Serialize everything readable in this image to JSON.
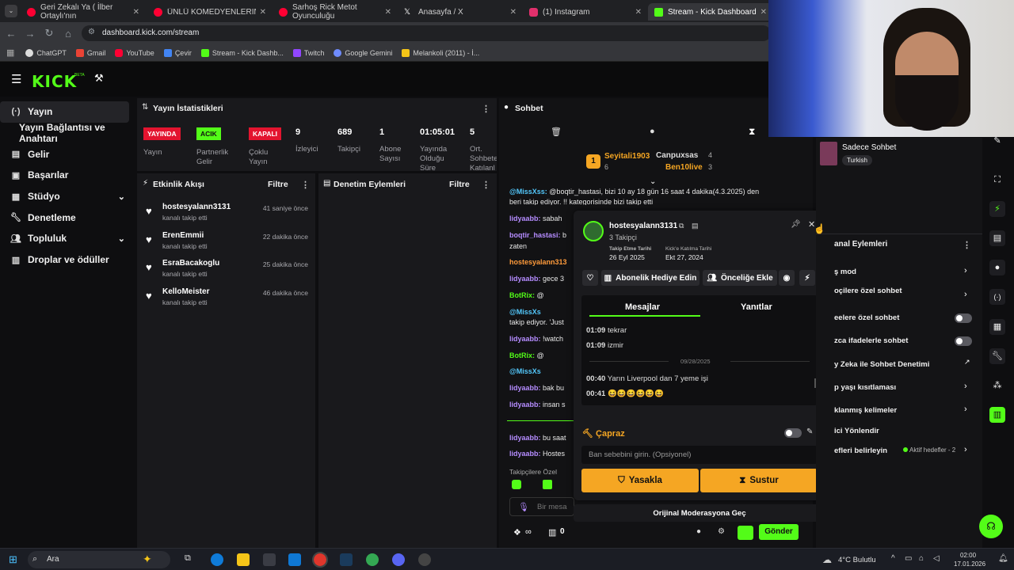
{
  "browser": {
    "tabs": [
      {
        "label": "Geri Zekalı Ya ( İlber Ortaylı'nın",
        "color": "#ff0033"
      },
      {
        "label": "ÜNLÜ KOMEDYENLERİN İLK VİDEOL",
        "color": "#ff0033"
      },
      {
        "label": "Sarhoş Rick Metot Oyunculuğu",
        "color": "#ff0033"
      },
      {
        "label": "Anasayfa / X",
        "color": "#ffffff"
      },
      {
        "label": "(1) Instagram",
        "color": "#e1306c"
      },
      {
        "label": "Stream - Kick Dashboard",
        "color": "#53fc18"
      }
    ],
    "url": "dashboard.kick.com/stream",
    "bookmarks": [
      "ChatGPT",
      "Gmail",
      "YouTube",
      "Çevir",
      "Stream - Kick Dashb...",
      "Twitch",
      "Google Gemini",
      "Melankoli (2011) - İ..."
    ]
  },
  "header": {
    "logo": "KICK",
    "beta": "BETA"
  },
  "sidebar": {
    "items": [
      {
        "label": "Yayın",
        "icon": "broadcast-icon"
      },
      {
        "label": "Yayın Bağlantısı ve Anahtarı",
        "icon": ""
      },
      {
        "label": "Gelir",
        "icon": "money-icon"
      },
      {
        "label": "Başarılar",
        "icon": "trophy-icon"
      },
      {
        "label": "Stüdyo",
        "icon": "studio-icon"
      },
      {
        "label": "Denetleme",
        "icon": "wrench-icon"
      },
      {
        "label": "Topluluk",
        "icon": "people-icon"
      },
      {
        "label": "Droplar ve ödüller",
        "icon": "gift-icon"
      }
    ]
  },
  "stats": {
    "title": "Yayın İstatistikleri",
    "items": [
      {
        "badge": "YAYINDA",
        "badge_color": "#e3142f",
        "label": "Yayın"
      },
      {
        "badge": "ACIK",
        "badge_color": "#53fc18",
        "label": "Partnerlik Gelir"
      },
      {
        "badge": "KAPALI",
        "badge_color": "#e3142f",
        "label": "Çoklu Yayın"
      },
      {
        "value": "9",
        "label": "İzleyici"
      },
      {
        "value": "689",
        "label": "Takipçi"
      },
      {
        "value": "1",
        "label": "Abone Sayısı"
      },
      {
        "value": "01:05:01",
        "label": "Yayında Olduğu Süre"
      },
      {
        "value": "5",
        "label": "Ort. Sohbete Katılanl"
      }
    ]
  },
  "activity": {
    "title": "Etkinlik Akışı",
    "filter": "Filtre",
    "items": [
      {
        "name": "hostesyalann3131",
        "sub": "kanalı takip etti",
        "time": "41 saniye önce"
      },
      {
        "name": "ErenEmmii",
        "sub": "kanalı takip etti",
        "time": "22 dakika önce"
      },
      {
        "name": "EsraBacakoglu",
        "sub": "kanalı takip etti",
        "time": "25 dakika önce"
      },
      {
        "name": "KelloMeister",
        "sub": "kanalı takip etti",
        "time": "46 dakika önce"
      }
    ]
  },
  "moderation": {
    "title": "Denetim Eylemleri",
    "filter": "Filtre"
  },
  "chat": {
    "title": "Sohbet",
    "leaderboard": [
      {
        "rank": "1",
        "name": "Seyitali1903",
        "count": "6"
      },
      {
        "name": "Canpuxsas",
        "count": "4"
      },
      {
        "name": "Ben10live",
        "count": "3"
      }
    ],
    "messages": [
      {
        "user": "@MissXss:",
        "text": " @boqtir_hastasi, bizi 10 ay 18 gün 16 saat 4 dakika(4.3.2025) den",
        "color": "#53c8fc"
      },
      {
        "user": "",
        "text": "beri takip ediyor. !! kategorisinde bizi takip etti",
        "color": "#e8e8e8"
      },
      {
        "user": "lidyaabb:",
        "text": " sabah",
        "color": "#b58cff"
      },
      {
        "user": "boqtir_hastasi:",
        "text": " b",
        "color": "#b58cff"
      },
      {
        "user": "",
        "text": "zaten",
        "color": "#e8e8e8"
      },
      {
        "user": "hostesyalann313",
        "text": "",
        "color": "#ff9b3b"
      },
      {
        "user": "lidyaabb:",
        "text": " gece 3",
        "color": "#b58cff"
      },
      {
        "user": "BotRix:",
        "text": " @",
        "color": "#53fc18"
      },
      {
        "user": "@MissXs",
        "text": "",
        "color": "#53c8fc"
      },
      {
        "user": "",
        "text": "takip ediyor. 'Just",
        "color": "#e8e8e8"
      },
      {
        "user": "lidyaabb:",
        "text": " !watch",
        "color": "#b58cff"
      },
      {
        "user": "BotRix:",
        "text": " @",
        "color": "#53fc18"
      },
      {
        "user": "@MissXs",
        "text": "",
        "color": "#53c8fc"
      },
      {
        "user": "lidyaabb:",
        "text": " bak bu",
        "color": "#b58cff"
      },
      {
        "user": "lidyaabb:",
        "text": " insan s",
        "color": "#b58cff"
      },
      {
        "user": "lidyaabb:",
        "text": " bu saat",
        "color": "#b58cff"
      },
      {
        "user": "lidyaabb:",
        "text": " Hostes",
        "color": "#b58cff"
      }
    ],
    "followers_only": "Takipçilere Özel",
    "input_placeholder": "Bir mesa",
    "send": "Gönder",
    "footer_count": "0"
  },
  "popup": {
    "username": "hostesyalann3131",
    "followers": "3 Takipçi",
    "follow_date_label": "Takip Etme Tarihi",
    "follow_date": "26 Eyl 2025",
    "join_date_label": "Kick'e Katılma Tarihi",
    "join_date": "Ekt 27, 2024",
    "gift_btn": "Abonelik Hediye Edin",
    "priority_btn": "Önceliğe Ekle",
    "tab_messages": "Mesajlar",
    "tab_replies": "Yanıtlar",
    "messages": [
      {
        "time": "01:09",
        "text": "tekrar"
      },
      {
        "time": "01:09",
        "text": "izmir"
      },
      {
        "time": "00:40",
        "text": "Yarın Liverpool dan 7 yeme işi"
      },
      {
        "time": "00:41",
        "text": "😆😆😆😆😆😆"
      }
    ],
    "date_divider": "09/28/2025",
    "cross_label": "Çapraz",
    "ban_placeholder": "Ban sebebini girin. (Opsiyonel)",
    "ban_btn": "Yasakla",
    "timeout_btn": "Sustur",
    "orig_mod": "Orijinal Moderasyona Geç"
  },
  "right_panel": {
    "chat_mode": "Sadece Sohbet",
    "language": "Turkish",
    "section_title": "anal Eylemleri",
    "items": [
      "ş mod",
      "oçilere özel sohbet",
      "eelere özel sohbet",
      "zca ifadelerle sohbet",
      "y Zeka ile Sohbet Denetimi",
      "p yaşı kısıtlaması",
      "klanmış kelimeler",
      "ici Yönlendir",
      "efleri belirleyin"
    ],
    "goals_status": "Aktif hedefler - 2"
  },
  "taskbar": {
    "search": "Ara",
    "weather": "4°C  Bulutlu",
    "time": "02:00",
    "date": "17.01.2026"
  },
  "colors": {
    "accent": "#53fc18",
    "live": "#e3142f",
    "ban": "#f5a623"
  }
}
